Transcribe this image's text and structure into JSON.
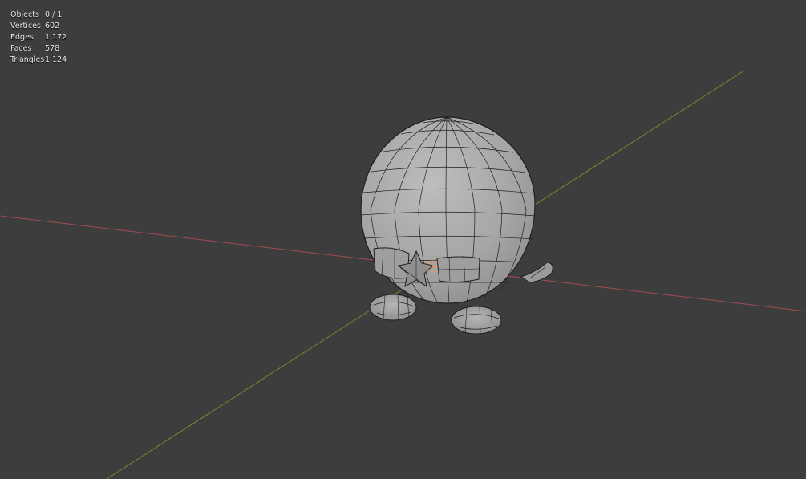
{
  "overlay": {
    "stats": [
      {
        "label": "Objects",
        "value": "0 / 1"
      },
      {
        "label": "Vertices",
        "value": "602"
      },
      {
        "label": "Edges",
        "value": "1,172"
      },
      {
        "label": "Faces",
        "value": "578"
      },
      {
        "label": "Triangles",
        "value": "1,124"
      }
    ]
  },
  "colors": {
    "background": "#3d3d3d",
    "x_axis": "#a14c51",
    "y_axis": "#6b8f2e",
    "mesh_fill": "#a8a8a8",
    "wire": "#1f1f1f",
    "origin": "#e8915f"
  }
}
